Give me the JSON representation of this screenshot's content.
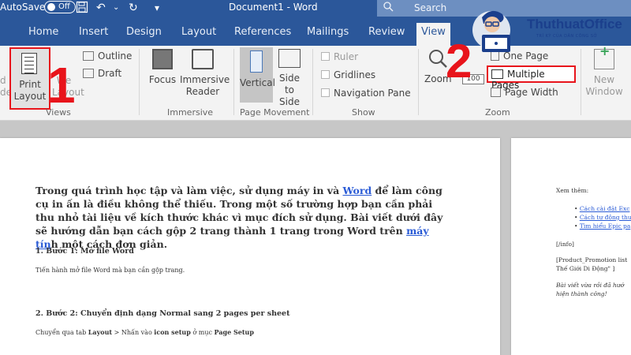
{
  "titlebar": {
    "autosave_label": "AutoSave",
    "autosave_state": "Off",
    "doc_title": "Document1 - Word",
    "search_placeholder": "Search"
  },
  "tabs": [
    "Home",
    "Insert",
    "Design",
    "Layout",
    "References",
    "Mailings",
    "Review",
    "View"
  ],
  "active_tab": "View",
  "ribbon": {
    "views": {
      "read_mode": [
        "d",
        "de"
      ],
      "print_layout": [
        "Print",
        "Layout"
      ],
      "web_layout": [
        "We",
        "Layout"
      ],
      "outline": "Outline",
      "draft": "Draft",
      "label": "Views"
    },
    "immersive": {
      "focus": "Focus",
      "immersive_reader": [
        "Immersive",
        "Reader"
      ],
      "label": "Immersive"
    },
    "page_movement": {
      "vertical": "Vertical",
      "side_to_side": [
        "Side",
        "to Side"
      ],
      "label": "Page Movement"
    },
    "show": {
      "ruler": "Ruler",
      "gridlines": "Gridlines",
      "navigation_pane": "Navigation Pane",
      "label": "Show"
    },
    "zoom": {
      "zoom": "Zoom",
      "percent": "100",
      "one_page": "One Page",
      "multiple_pages": "Multiple Pages",
      "page_width": "Page Width",
      "label": "Zoom"
    },
    "window": {
      "new_window": [
        "New",
        "Window"
      ]
    }
  },
  "annotations": {
    "step1": "1",
    "step2": "2"
  },
  "logo": {
    "name": "ThuthuatOffice",
    "tagline": "TRÍ KỲ CỦA DÂN CÔNG SỞ"
  },
  "document": {
    "intro_parts": [
      "Trong quá trình học tập và làm việc, sử dụng máy in và ",
      "Word",
      " để làm công cụ in ấn là điều không thể thiếu. Trong một số trường hợp bạn cần phải thu nhỏ tài liệu về kích thước khác vì mục đích sử dụng. Bài viết dưới đây sẽ hướng dẫn bạn cách gộp 2 trang thành 1 trang trong Word trên ",
      "máy tín",
      "h một cách đơn giản."
    ],
    "step1_heading": "1. Bước 1: Mở file Word",
    "step1_text": "Tiến hành mở file Word mà bạn cần gộp trang.",
    "step2_heading": "2. Bước 2: Chuyển định dạng Normal sang 2 pages per sheet",
    "step2_parts": [
      "Chuyển qua tab ",
      "Layout",
      " > Nhấn vào ",
      "icon setup",
      " ở mục ",
      "Page Setup"
    ]
  },
  "page2": {
    "see_more": "Xem thêm:",
    "links": [
      "Cách cài đặt Exc",
      "Cách tự động thu",
      "Tìm hiểu Epic pa"
    ],
    "info": "[/info]",
    "promo_1": "[Product_Promotion list",
    "promo_2": "Thế Giới Di Động\" ]",
    "end_1": "Bài viết vừa rồi đã hướ",
    "end_2": "hiện thành công!"
  }
}
